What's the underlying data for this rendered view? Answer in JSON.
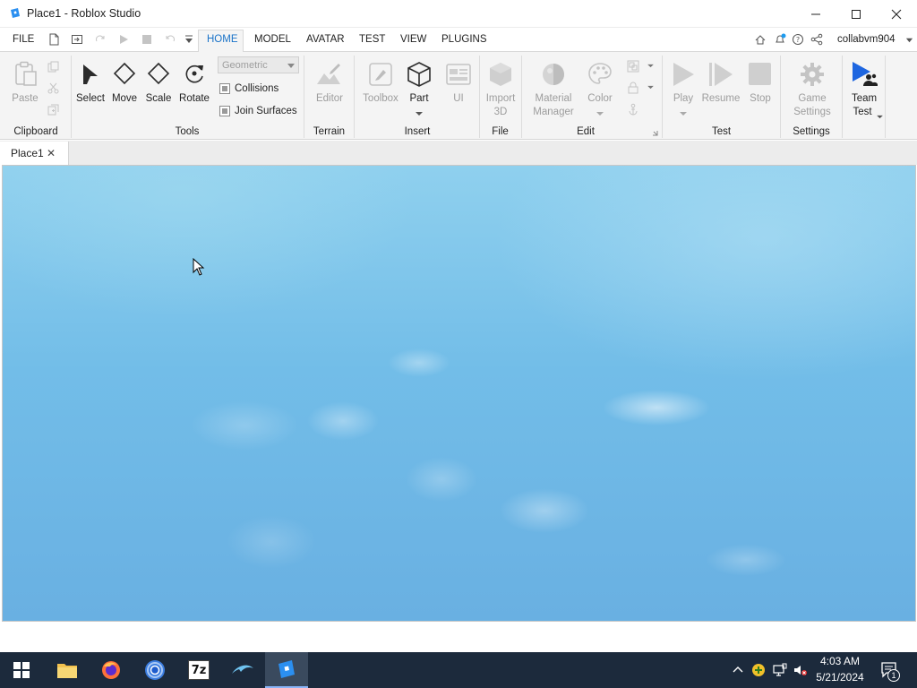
{
  "window": {
    "title": "Place1 - Roblox Studio",
    "minimize_glyph": "—",
    "maximize_glyph": "☐",
    "close_glyph": "✕"
  },
  "menu": {
    "file": "FILE",
    "tabs": [
      "HOME",
      "MODEL",
      "AVATAR",
      "TEST",
      "VIEW",
      "PLUGINS"
    ],
    "active_tab": "HOME",
    "username": "collabvm904"
  },
  "ribbon": {
    "clipboard": {
      "paste": "Paste",
      "group": "Clipboard"
    },
    "tools": {
      "select": "Select",
      "move": "Move",
      "scale": "Scale",
      "rotate": "Rotate",
      "mode_value": "Geometric",
      "collisions": "Collisions",
      "join_surfaces": "Join Surfaces",
      "group": "Tools"
    },
    "terrain": {
      "editor": "Editor",
      "group": "Terrain"
    },
    "insert": {
      "toolbox": "Toolbox",
      "part": "Part",
      "ui": "UI",
      "group": "Insert"
    },
    "file": {
      "import_line1": "Import",
      "import_line2": "3D",
      "group": "File"
    },
    "edit": {
      "material_line1": "Material",
      "material_line2": "Manager",
      "color": "Color",
      "group": "Edit"
    },
    "test": {
      "play": "Play",
      "resume": "Resume",
      "stop": "Stop",
      "group": "Test"
    },
    "settings": {
      "line1": "Game",
      "line2": "Settings",
      "group": "Settings"
    },
    "team_test": {
      "line1": "Team",
      "line2": "Test"
    }
  },
  "document": {
    "tab_label": "Place1",
    "close_glyph": "✕"
  },
  "taskbar": {
    "apps": [
      "windows-start",
      "file-explorer",
      "firefox",
      "chrome",
      "7-zip",
      "dolphin",
      "roblox-studio"
    ],
    "app_7zip_label": "7z",
    "clock_time": "4:03 AM",
    "clock_date": "5/21/2024",
    "notification_count": "1"
  },
  "colors": {
    "accent": "#1d9bf0",
    "taskbar": "#1c2a3c",
    "ribbon_bg": "#f4f4f4"
  }
}
